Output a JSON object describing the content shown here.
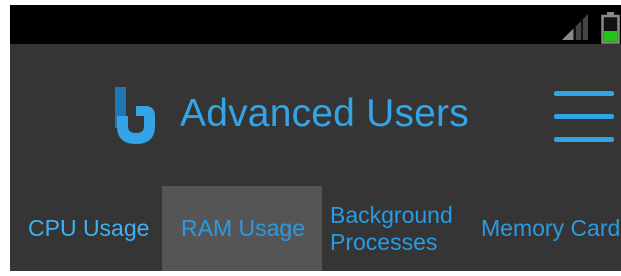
{
  "status_bar": {
    "icons": [
      "signal-icon",
      "battery-icon"
    ],
    "battery_color": "#22c51a"
  },
  "app_bar": {
    "title": "Advanced Users",
    "logo": "b-logo",
    "menu_icon": "hamburger-menu-icon",
    "accent_color": "#33a5e6"
  },
  "tabs": [
    {
      "label": "CPU Usage",
      "state": "active"
    },
    {
      "label": "RAM Usage",
      "state": "selected"
    },
    {
      "label_line1": "Background",
      "label_line2": "Processes"
    },
    {
      "label": "Memory Card"
    }
  ]
}
